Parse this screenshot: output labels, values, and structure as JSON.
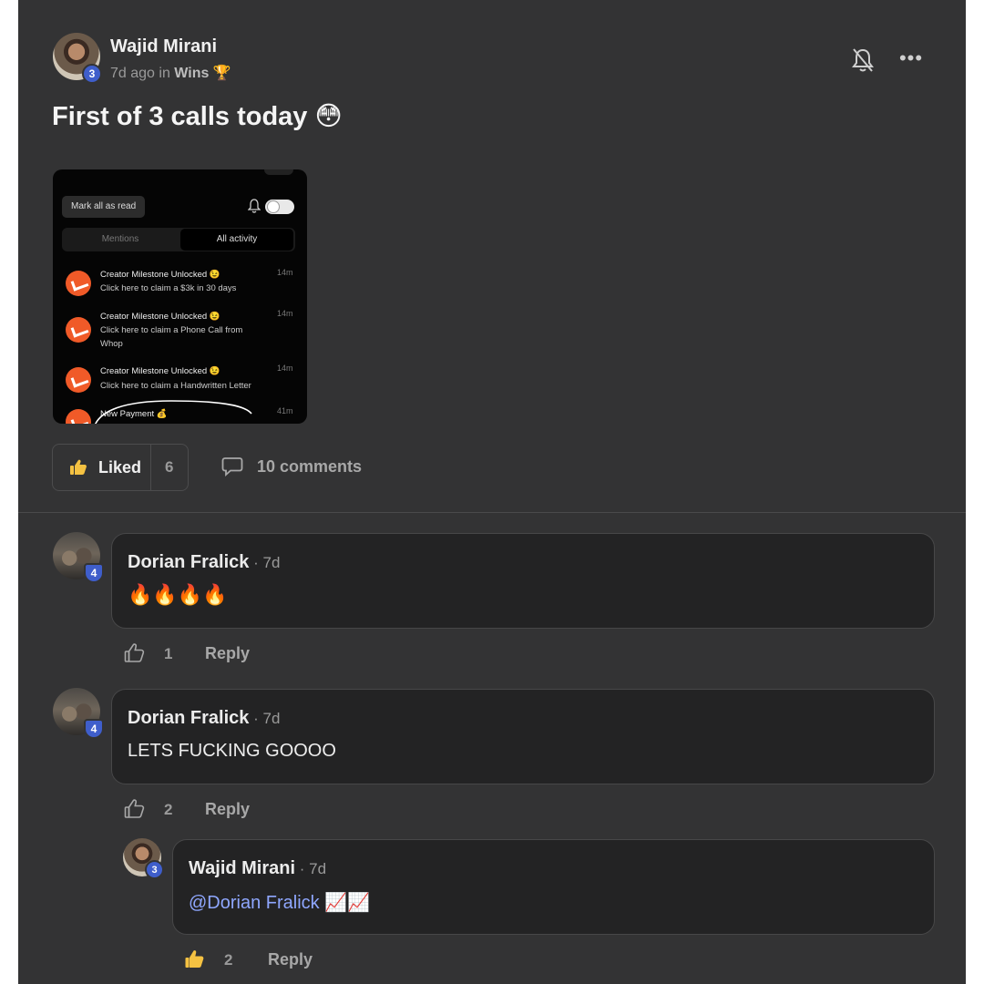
{
  "post": {
    "author": "Wajid Mirani",
    "level": "3",
    "time_ago": "7d ago in",
    "category": "Wins",
    "category_emoji": "🏆",
    "title": "First of 3 calls today",
    "title_emoji": "😳",
    "more_label": "•••",
    "attachment": {
      "mark_all_read": "Mark all as read",
      "tabs": [
        "Mentions",
        "All activity"
      ],
      "notifications": [
        {
          "title": "Creator Milestone Unlocked 😉",
          "body": "Click here to claim a $3k in 30 days",
          "time": "14m"
        },
        {
          "title": "Creator Milestone Unlocked 😉",
          "body": "Click here to claim a Phone Call from Whop",
          "time": "14m"
        },
        {
          "title": "Creator Milestone Unlocked 😉",
          "body": "Click here to claim a Handwritten Letter",
          "time": "14m"
        },
        {
          "title": "New Payment 💰",
          "body": "",
          "time": "41m"
        }
      ]
    },
    "like_label": "Liked",
    "like_count": "6",
    "comments_label": "10 comments"
  },
  "comments": [
    {
      "author": "Dorian Fralick",
      "time": " · 7d",
      "level": "4",
      "text": "🔥🔥🔥🔥",
      "likes": "1",
      "reply_label": "Reply"
    },
    {
      "author": "Dorian Fralick",
      "time": " · 7d",
      "level": "4",
      "text": "LETS FUCKING GOOOO",
      "likes": "2",
      "reply_label": "Reply"
    },
    {
      "author": "Wajid Mirani",
      "time": " · 7d",
      "level": "3",
      "mention": "@Dorian Fralick",
      "text_after": " 📈📈",
      "likes": "2",
      "reply_label": "Reply"
    }
  ],
  "colors": {
    "accent": "#3f5ecb",
    "mention": "#8fa7ff",
    "brand_orange": "#f05a28",
    "liked_yellow": "#f5c242"
  }
}
